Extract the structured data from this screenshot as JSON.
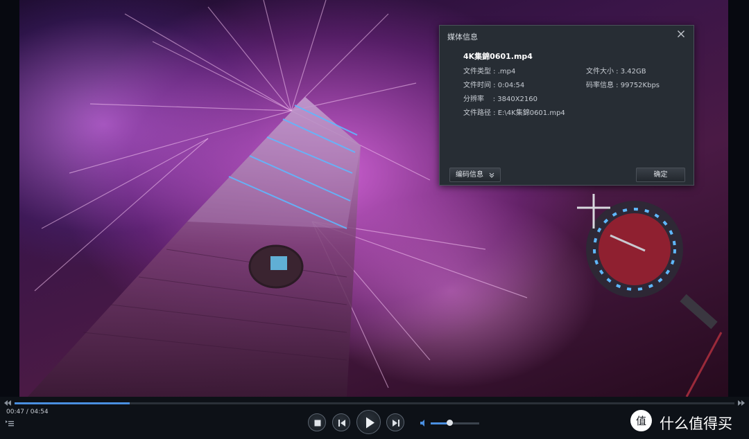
{
  "dialog": {
    "title": "媒体信息",
    "filename": "4K集錦0601.mp4",
    "file_type": "文件类型 : .mp4",
    "file_duration": "文件时间 : 0:04:54",
    "resolution": "分辨率    : 3840X2160",
    "file_path": "文件路径 : E:\\4K集錦0601.mp4",
    "file_size": "文件大小 : 3.42GB",
    "bitrate": "码率信息 : 99752Kbps",
    "codec_button": "编码信息",
    "ok_button": "确定"
  },
  "player": {
    "time_display": "00:47 / 04:54",
    "progress": 0.16,
    "volume": 0.38
  },
  "watermark": {
    "text": "什么值得买",
    "logo_glyph": "值"
  },
  "colors": {
    "accent": "#4a8fe0",
    "dialog_bg": "#272d34",
    "bar_bg": "#0d1117"
  },
  "icons": [
    "close-icon",
    "chevron-down-icon",
    "skip-back-icon",
    "skip-forward-icon",
    "playlist-icon",
    "stop-icon",
    "previous-icon",
    "play-icon",
    "next-icon",
    "volume-icon"
  ]
}
